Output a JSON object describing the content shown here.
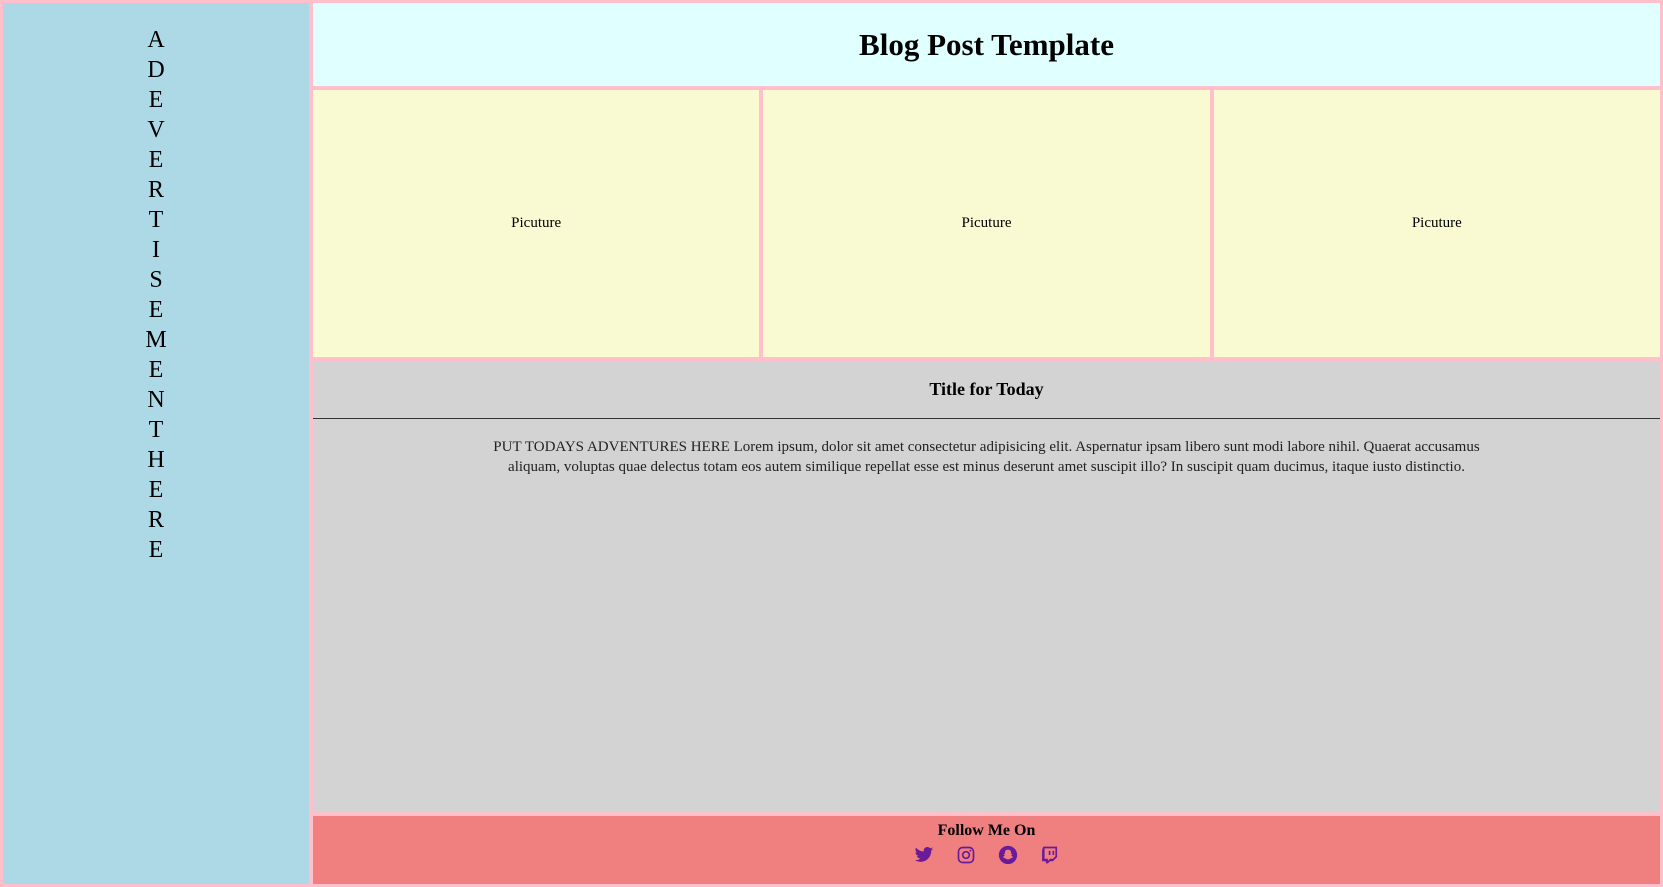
{
  "sidebar": {
    "ad_letters": [
      "A",
      "D",
      "E",
      "V",
      "E",
      "R",
      "T",
      "I",
      "S",
      "E",
      "M",
      "E",
      "N",
      "T",
      "H",
      "E",
      "R",
      "E"
    ]
  },
  "header": {
    "title": "Blog Post Template"
  },
  "pictures": [
    {
      "label": "Picuture"
    },
    {
      "label": "Picuture"
    },
    {
      "label": "Picuture"
    }
  ],
  "post": {
    "title": "Title for Today",
    "body": "PUT TODAYS ADVENTURES HERE Lorem ipsum, dolor sit amet consectetur adipisicing elit. Aspernatur ipsam libero sunt modi labore nihil. Quaerat accusamus aliquam, voluptas quae delectus totam eos autem similique repellat esse est minus deserunt amet suscipit illo? In suscipit quam ducimus, itaque iusto distinctio."
  },
  "footer": {
    "follow_label": "Follow Me On",
    "social_icons": [
      "twitter-icon",
      "instagram-icon",
      "snapchat-icon",
      "twitch-icon"
    ],
    "icon_color": "#6a1b9a"
  },
  "colors": {
    "sidebar_bg": "#add8e6",
    "header_bg": "#e0ffff",
    "picture_bg": "#fafad2",
    "content_bg": "#d3d3d3",
    "footer_bg": "#f08080",
    "border": "#ffc0cb"
  }
}
